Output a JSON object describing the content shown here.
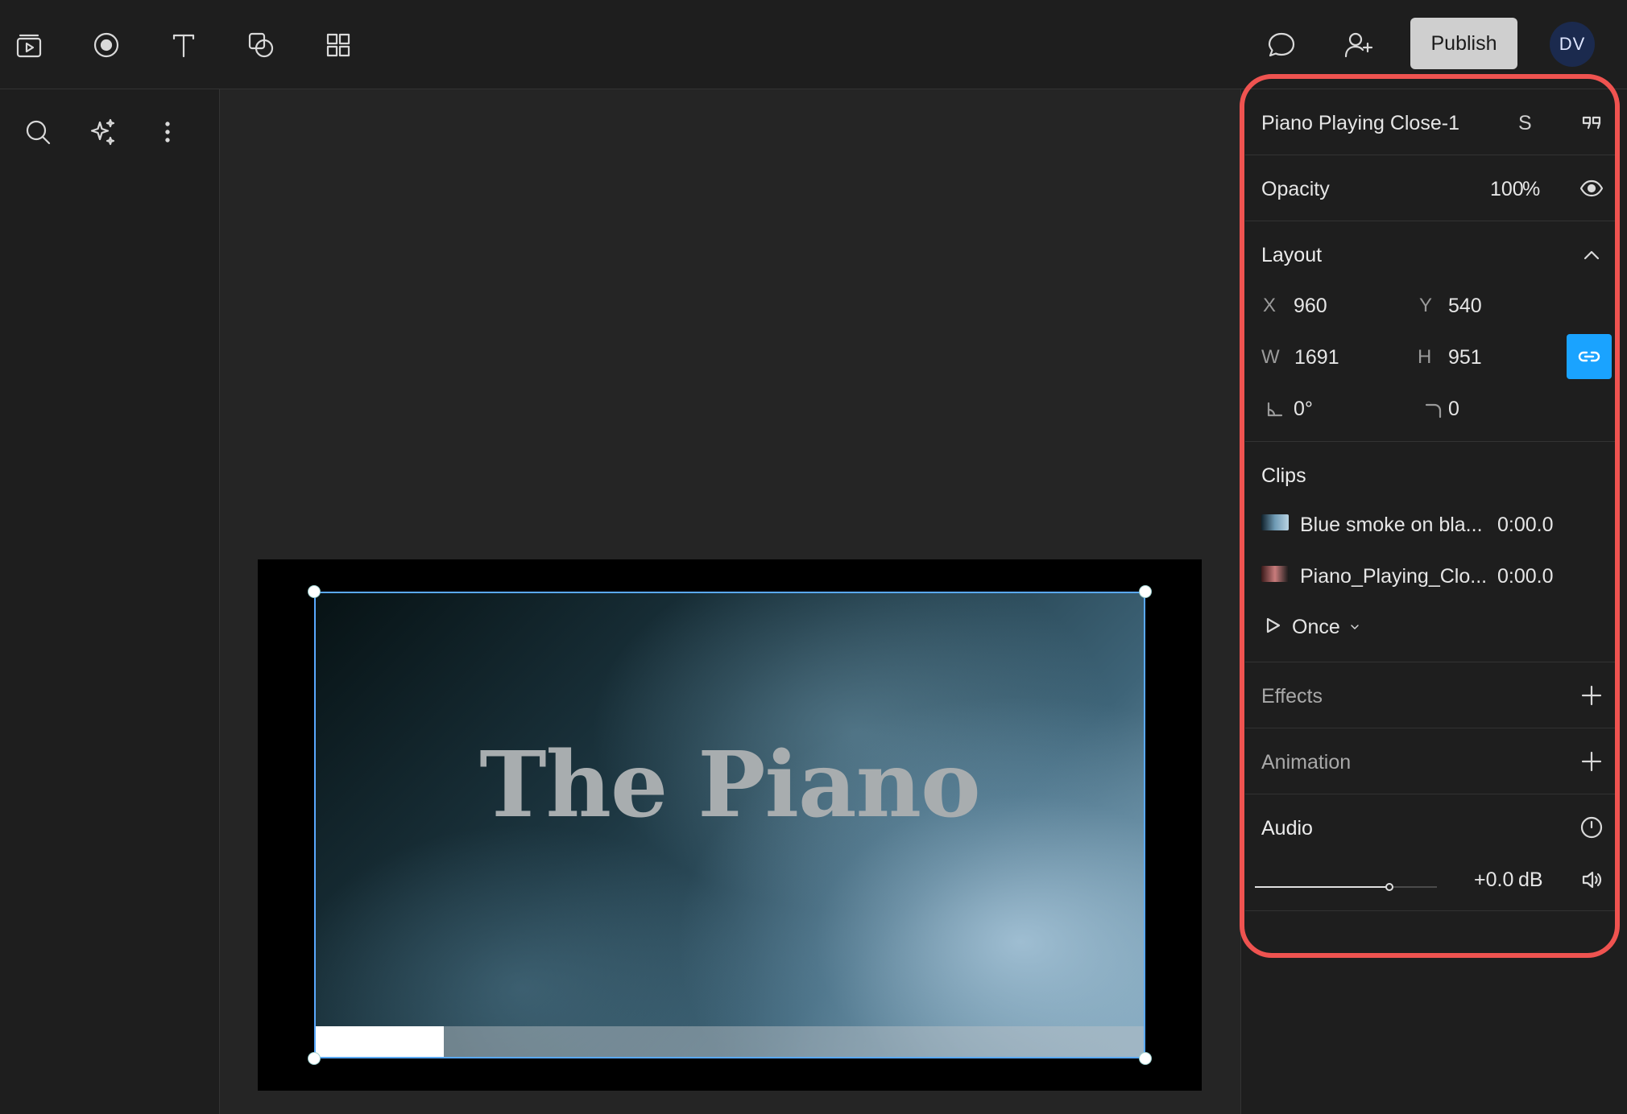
{
  "toolbar": {
    "icons": [
      "video-frame-icon",
      "record-icon",
      "text-icon",
      "shapes-icon",
      "grid-icon"
    ],
    "publish_label": "Publish",
    "user_initials": "DV"
  },
  "sidebar": {
    "icons": [
      "search-icon",
      "sparkle-icon",
      "more-vertical-icon"
    ]
  },
  "canvas": {
    "video_title": "The Piano",
    "playback_progress": 0.156
  },
  "panel": {
    "layer_name": "Piano Playing Close-1",
    "layer_shortcut": "S",
    "opacity": {
      "label": "Opacity",
      "value": "100",
      "unit": "%"
    },
    "layout": {
      "title": "Layout",
      "x_label": "X",
      "x_value": "960",
      "y_label": "Y",
      "y_value": "540",
      "w_label": "W",
      "w_value": "1691",
      "h_label": "H",
      "h_value": "951",
      "rotation_value": "0°",
      "radius_value": "0"
    },
    "clips": {
      "title": "Clips",
      "items": [
        {
          "name": "Blue smoke on bla...",
          "time": "0:00.0"
        },
        {
          "name": "Piano_Playing_Clo...",
          "time": "0:00.0"
        }
      ],
      "loop_mode": "Once"
    },
    "effects": {
      "title": "Effects"
    },
    "animation": {
      "title": "Animation"
    },
    "audio": {
      "title": "Audio",
      "gain_value": "+0.0",
      "gain_unit": "dB",
      "volume_level": 0.74
    }
  },
  "colors": {
    "accent": "#1aa3ff",
    "highlight": "#ef5350",
    "publish_bg": "#cfcfcf",
    "avatar_bg": "#1b2a4e"
  }
}
